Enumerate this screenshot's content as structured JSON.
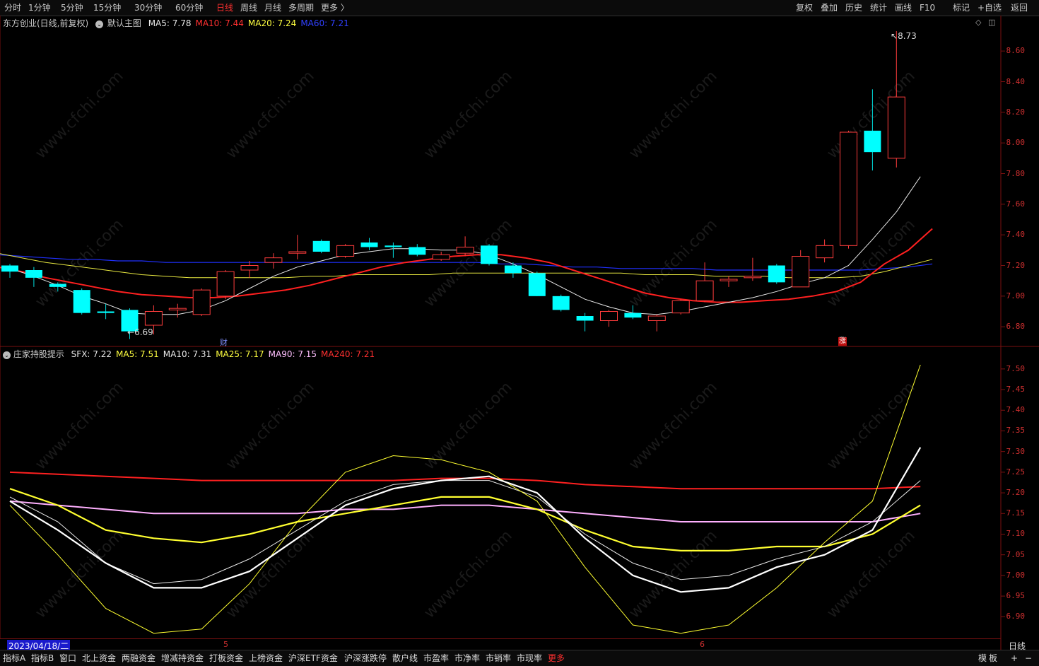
{
  "toolbar": {
    "periods": [
      "分时",
      "1分钟",
      "5分钟",
      "15分钟",
      "30分钟",
      "60分钟",
      "日线",
      "周线",
      "月线",
      "多周期",
      "更多 〉"
    ],
    "active": "日线",
    "right_buttons": [
      "复权",
      "叠加",
      "历史",
      "统计",
      "画线",
      "F10",
      "标记",
      "+自选",
      "返回"
    ]
  },
  "main_panel": {
    "title": "东方创业(日线,前复权)",
    "indicator": "默认主图",
    "ma": [
      {
        "label": "MA5: 7.78",
        "color": "#e8e8e8"
      },
      {
        "label": "MA10: 7.44",
        "color": "#ff3030"
      },
      {
        "label": "MA20: 7.24",
        "color": "#ffff40"
      },
      {
        "label": "MA60: 7.21",
        "color": "#3040ff"
      }
    ],
    "high_label": "8.73",
    "low_label": "6.69",
    "y_ticks": [
      "8.60",
      "8.40",
      "8.20",
      "8.00",
      "7.80",
      "7.60",
      "7.40",
      "7.20",
      "7.00",
      "6.80"
    ],
    "marker_cai": "财",
    "marker_zhang": "涨"
  },
  "sub_panel": {
    "title": "庄家持股提示",
    "lines": [
      {
        "label": "SFX: 7.22",
        "color": "#e8e8e8"
      },
      {
        "label": "MA5: 7.51",
        "color": "#ffff40"
      },
      {
        "label": "MA10: 7.31",
        "color": "#e8e8e8"
      },
      {
        "label": "MA25: 7.17",
        "color": "#ffff40"
      },
      {
        "label": "MA90: 7.15",
        "color": "#ffc0ff"
      },
      {
        "label": "MA240: 7.21",
        "color": "#ff3030"
      }
    ],
    "y_ticks": [
      "7.50",
      "7.45",
      "7.40",
      "7.35",
      "7.30",
      "7.25",
      "7.20",
      "7.15",
      "7.10",
      "7.05",
      "7.00",
      "6.95",
      "6.90"
    ]
  },
  "date_axis": {
    "start_date": "2023/04/18/二",
    "month_marks": [
      "5",
      "6"
    ],
    "period_label": "日线"
  },
  "bottom_tabs": [
    "指标A",
    "指标B",
    "窗口",
    "北上资金",
    "两融资金",
    "增减持资金",
    "打板资金",
    "上榜资金",
    "沪深ETF资金",
    "沪深涨跌停",
    "散户线",
    "市盈率",
    "市净率",
    "市销率",
    "市现率",
    "更多"
  ],
  "bottom_right": [
    "模",
    "板",
    "+",
    "−"
  ],
  "watermark": "www.cfchi.com",
  "chart_data": {
    "type": "candlestick",
    "candles": [
      [
        7.2,
        7.16,
        7.21,
        7.12
      ],
      [
        7.17,
        7.12,
        7.19,
        7.06
      ],
      [
        7.08,
        7.06,
        7.09,
        7.03
      ],
      [
        7.04,
        6.89,
        7.05,
        6.88
      ],
      [
        6.9,
        6.89,
        6.95,
        6.85
      ],
      [
        6.91,
        6.77,
        6.92,
        6.72
      ],
      [
        6.81,
        6.9,
        6.94,
        6.75
      ],
      [
        6.91,
        6.92,
        6.95,
        6.86
      ],
      [
        6.88,
        7.04,
        7.05,
        6.87
      ],
      [
        7.0,
        7.16,
        7.17,
        6.98
      ],
      [
        7.17,
        7.2,
        7.23,
        7.12
      ],
      [
        7.22,
        7.25,
        7.28,
        7.18
      ],
      [
        7.28,
        7.29,
        7.4,
        7.24
      ],
      [
        7.36,
        7.29,
        7.37,
        7.28
      ],
      [
        7.26,
        7.33,
        7.34,
        7.25
      ],
      [
        7.35,
        7.32,
        7.38,
        7.3
      ],
      [
        7.33,
        7.32,
        7.35,
        7.25
      ],
      [
        7.32,
        7.27,
        7.34,
        7.26
      ],
      [
        7.24,
        7.27,
        7.29,
        7.23
      ],
      [
        7.28,
        7.32,
        7.39,
        7.26
      ],
      [
        7.33,
        7.21,
        7.34,
        7.2
      ],
      [
        7.2,
        7.15,
        7.22,
        7.12
      ],
      [
        7.15,
        7.0,
        7.16,
        7.0
      ],
      [
        7.0,
        6.91,
        7.01,
        6.9
      ],
      [
        6.87,
        6.84,
        6.89,
        6.77
      ],
      [
        6.84,
        6.9,
        6.91,
        6.8
      ],
      [
        6.89,
        6.86,
        6.94,
        6.85
      ],
      [
        6.84,
        6.87,
        6.88,
        6.77
      ],
      [
        6.89,
        6.97,
        6.98,
        6.88
      ],
      [
        6.97,
        7.1,
        7.22,
        6.96
      ],
      [
        7.1,
        7.11,
        7.13,
        7.06
      ],
      [
        7.12,
        7.13,
        7.25,
        7.1
      ],
      [
        7.2,
        7.09,
        7.21,
        7.08
      ],
      [
        7.06,
        7.26,
        7.3,
        7.06
      ],
      [
        7.25,
        7.33,
        7.37,
        7.22
      ],
      [
        7.33,
        8.07,
        8.08,
        7.31
      ],
      [
        8.08,
        7.94,
        8.35,
        7.82
      ],
      [
        7.9,
        8.3,
        8.73,
        7.84
      ]
    ],
    "ma5": [
      7.18,
      7.13,
      7.07,
      7.0,
      6.95,
      6.89,
      6.88,
      6.88,
      6.91,
      6.97,
      7.05,
      7.13,
      7.19,
      7.23,
      7.27,
      7.29,
      7.31,
      7.31,
      7.3,
      7.3,
      7.27,
      7.21,
      7.14,
      7.06,
      6.98,
      6.93,
      6.89,
      6.88,
      6.9,
      6.93,
      6.96,
      6.99,
      7.03,
      7.08,
      7.12,
      7.2,
      7.37,
      7.55,
      7.78
    ],
    "ma10": [
      7.19,
      7.16,
      7.12,
      7.09,
      7.06,
      7.03,
      7.01,
      7.0,
      6.99,
      6.99,
      7.0,
      7.02,
      7.04,
      7.07,
      7.11,
      7.15,
      7.19,
      7.22,
      7.24,
      7.26,
      7.27,
      7.27,
      7.25,
      7.22,
      7.17,
      7.12,
      7.07,
      7.02,
      6.99,
      6.97,
      6.96,
      6.96,
      6.97,
      6.98,
      7.0,
      7.03,
      7.09,
      7.21,
      7.3,
      7.44
    ],
    "ma20": [
      7.28,
      7.25,
      7.22,
      7.2,
      7.18,
      7.16,
      7.14,
      7.13,
      7.12,
      7.12,
      7.12,
      7.12,
      7.12,
      7.13,
      7.13,
      7.14,
      7.14,
      7.14,
      7.14,
      7.15,
      7.15,
      7.15,
      7.15,
      7.15,
      7.15,
      7.15,
      7.15,
      7.14,
      7.14,
      7.14,
      7.13,
      7.13,
      7.13,
      7.12,
      7.12,
      7.12,
      7.13,
      7.16,
      7.2,
      7.24
    ],
    "ma60": [
      7.27,
      7.26,
      7.25,
      7.24,
      7.24,
      7.23,
      7.23,
      7.22,
      7.22,
      7.22,
      7.22,
      7.22,
      7.22,
      7.22,
      7.22,
      7.22,
      7.22,
      7.22,
      7.22,
      7.22,
      7.22,
      7.21,
      7.21,
      7.2,
      7.19,
      7.19,
      7.18,
      7.18,
      7.18,
      7.18,
      7.17,
      7.17,
      7.17,
      7.17,
      7.17,
      7.17,
      7.17,
      7.18,
      7.19,
      7.21
    ],
    "ylim_main": [
      6.69,
      8.73
    ],
    "sub_series": {
      "x": [
        0,
        2,
        4,
        6,
        8,
        10,
        12,
        14,
        16,
        18,
        20,
        22,
        24,
        26,
        28,
        30,
        32,
        34,
        36,
        38
      ],
      "sfx": [
        7.18,
        7.11,
        7.03,
        6.97,
        6.97,
        7.01,
        7.09,
        7.17,
        7.21,
        7.23,
        7.24,
        7.2,
        7.09,
        7.0,
        6.96,
        6.97,
        7.02,
        7.05,
        7.11,
        7.31
      ],
      "ma5": [
        7.17,
        7.05,
        6.92,
        6.86,
        6.87,
        6.98,
        7.13,
        7.25,
        7.29,
        7.28,
        7.25,
        7.18,
        7.02,
        6.88,
        6.86,
        6.88,
        6.97,
        7.08,
        7.18,
        7.51
      ],
      "ma10": [
        7.19,
        7.13,
        7.03,
        6.98,
        6.99,
        7.04,
        7.11,
        7.18,
        7.22,
        7.23,
        7.23,
        7.19,
        7.1,
        7.03,
        6.99,
        7.0,
        7.04,
        7.07,
        7.13,
        7.23
      ],
      "ma25": [
        7.21,
        7.17,
        7.11,
        7.09,
        7.08,
        7.1,
        7.13,
        7.15,
        7.17,
        7.19,
        7.19,
        7.16,
        7.11,
        7.07,
        7.06,
        7.06,
        7.07,
        7.07,
        7.1,
        7.17
      ],
      "ma90": [
        7.18,
        7.17,
        7.16,
        7.15,
        7.15,
        7.15,
        7.15,
        7.16,
        7.16,
        7.17,
        7.17,
        7.16,
        7.15,
        7.14,
        7.13,
        7.13,
        7.13,
        7.13,
        7.13,
        7.15
      ],
      "ma240": [
        7.25,
        7.245,
        7.24,
        7.235,
        7.23,
        7.23,
        7.23,
        7.23,
        7.23,
        7.235,
        7.235,
        7.23,
        7.22,
        7.215,
        7.21,
        7.21,
        7.21,
        7.21,
        7.21,
        7.215
      ]
    },
    "ylim_sub": [
      6.87,
      7.52
    ]
  }
}
